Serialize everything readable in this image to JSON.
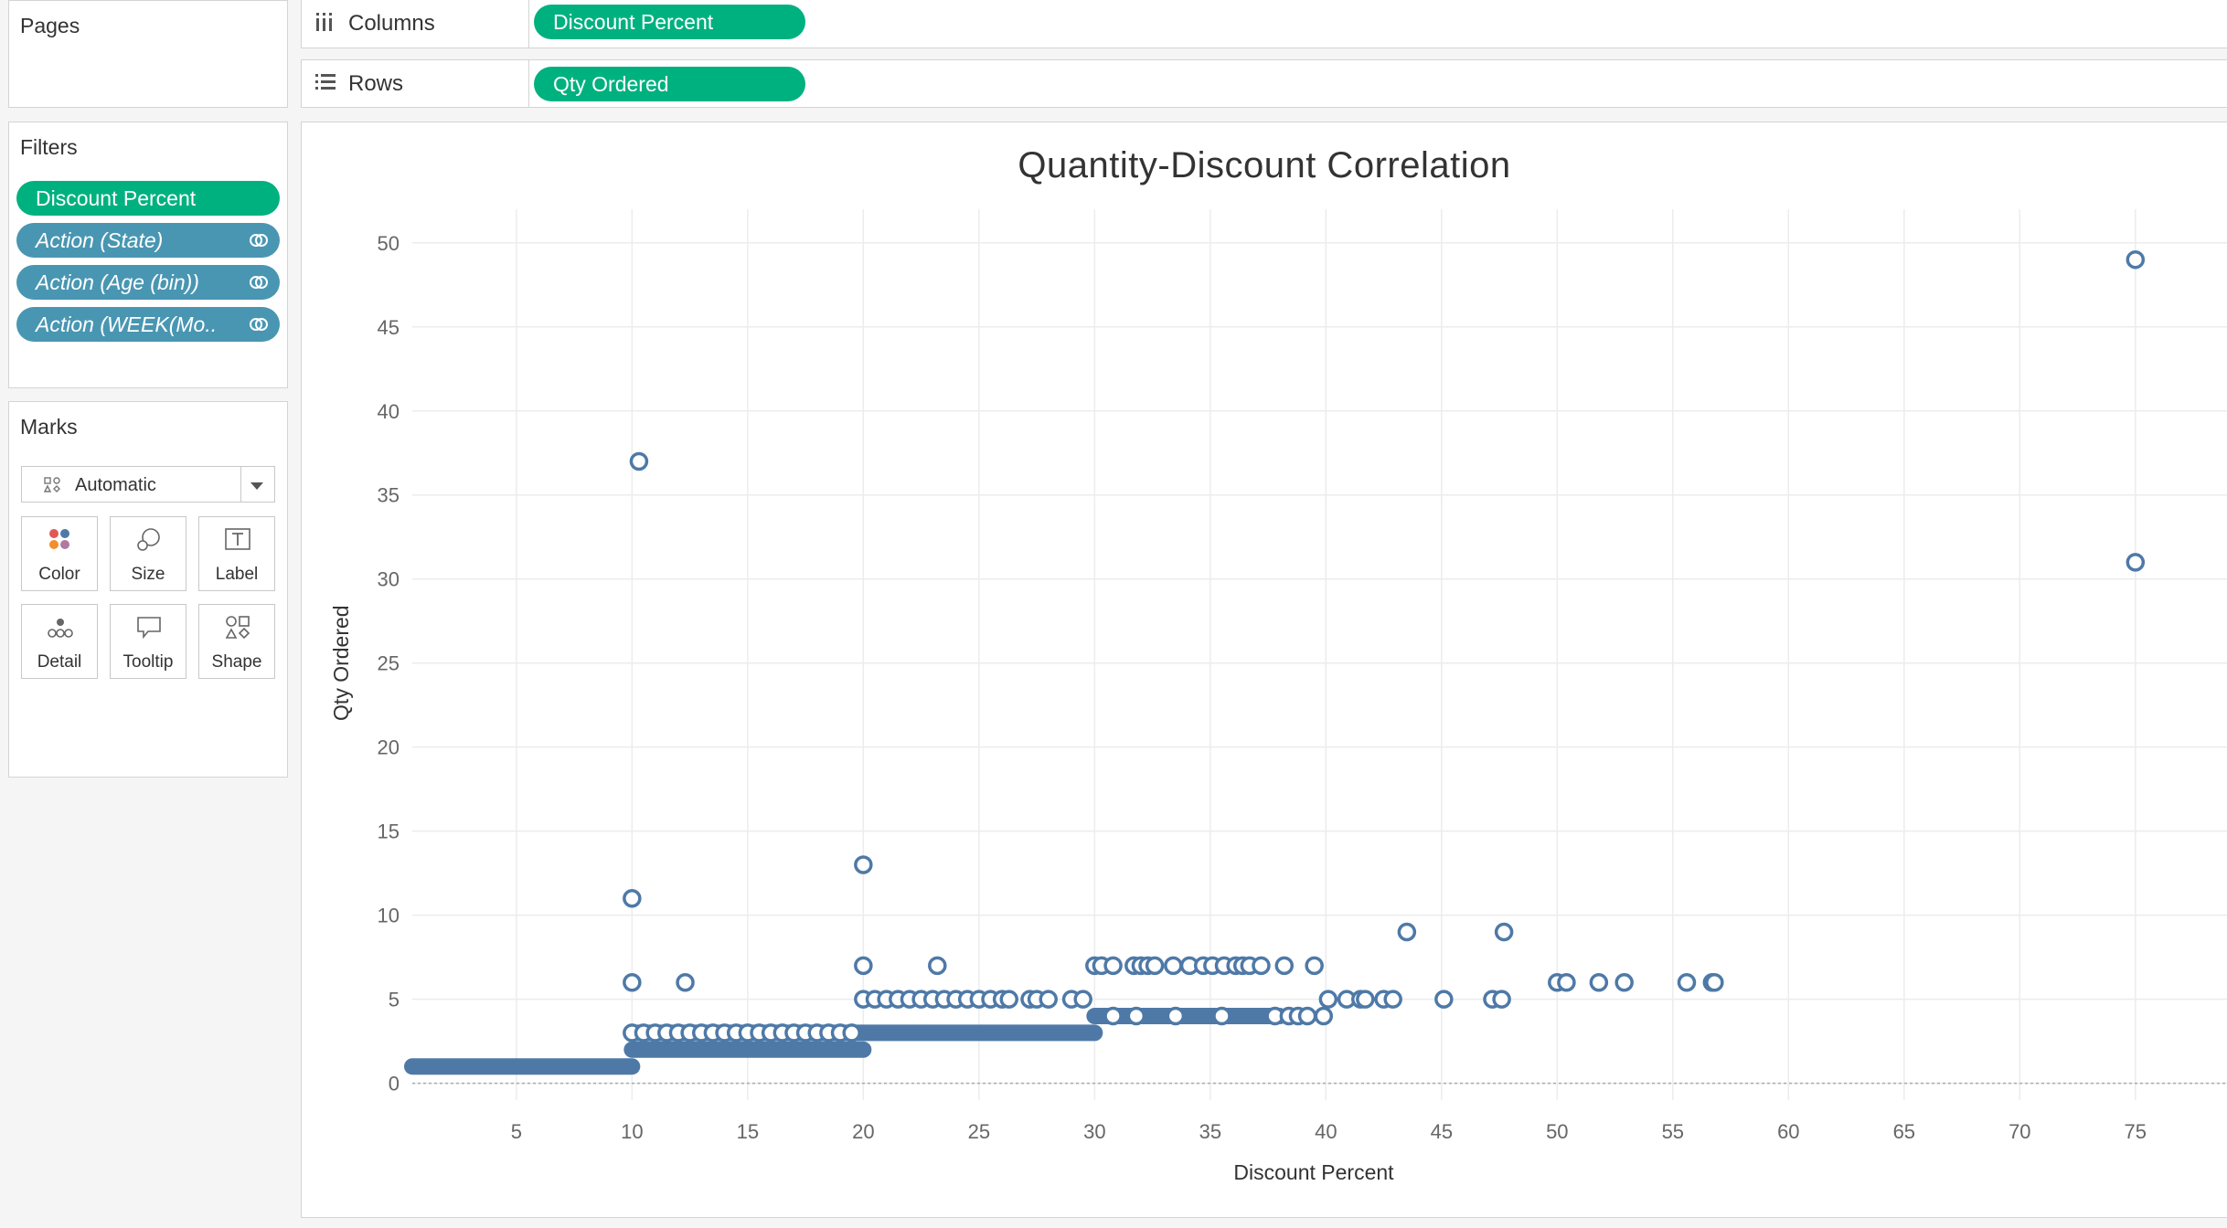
{
  "sidebar": {
    "pages": {
      "title": "Pages"
    },
    "filters": {
      "title": "Filters",
      "items": [
        {
          "label": "Discount Percent",
          "kind": "measure"
        },
        {
          "label": "Action (State)",
          "kind": "action"
        },
        {
          "label": "Action (Age (bin))",
          "kind": "action"
        },
        {
          "label": "Action (WEEK(Mo..",
          "kind": "action"
        }
      ]
    },
    "marks": {
      "title": "Marks",
      "type_select": "Automatic",
      "buttons": [
        {
          "label": "Color",
          "icon": "color-icon"
        },
        {
          "label": "Size",
          "icon": "size-icon"
        },
        {
          "label": "Label",
          "icon": "label-icon"
        },
        {
          "label": "Detail",
          "icon": "detail-icon"
        },
        {
          "label": "Tooltip",
          "icon": "tooltip-icon"
        },
        {
          "label": "Shape",
          "icon": "shape-icon"
        }
      ]
    }
  },
  "shelves": {
    "columns": {
      "label": "Columns",
      "pill": "Discount Percent"
    },
    "rows": {
      "label": "Rows",
      "pill": "Qty Ordered"
    }
  },
  "colors": {
    "measure_pill": "#00b180",
    "action_pill": "#4996b2",
    "mark": "#4e79a7"
  },
  "chart_data": {
    "type": "scatter",
    "title": "Quantity-Discount Correlation",
    "xlabel": "Discount Percent",
    "ylabel": "Qty Ordered",
    "xlim": [
      0.5,
      79
    ],
    "ylim": [
      -1,
      52
    ],
    "xticks": [
      5,
      10,
      15,
      20,
      25,
      30,
      35,
      40,
      45,
      50,
      55,
      60,
      65,
      70,
      75
    ],
    "yticks": [
      0,
      5,
      10,
      15,
      20,
      25,
      30,
      35,
      40,
      45,
      50
    ],
    "grid": true,
    "marker": "open-circle",
    "bands": [
      {
        "y": 1,
        "x_from": 0.5,
        "x_to": 10
      },
      {
        "y": 2,
        "x_from": 10,
        "x_to": 20
      },
      {
        "y": 3,
        "x_from": 10,
        "x_to": 30
      },
      {
        "y": 4,
        "x_from": 30,
        "x_to": 38
      }
    ],
    "points": [
      [
        10.3,
        37
      ],
      [
        75,
        49
      ],
      [
        75,
        31
      ],
      [
        10,
        11
      ],
      [
        20,
        13
      ],
      [
        10,
        6
      ],
      [
        12.3,
        6
      ],
      [
        20,
        7
      ],
      [
        23.2,
        7
      ],
      [
        10,
        3
      ],
      [
        10.5,
        3
      ],
      [
        11,
        3
      ],
      [
        11.5,
        3
      ],
      [
        12,
        3
      ],
      [
        12.5,
        3
      ],
      [
        13,
        3
      ],
      [
        13.5,
        3
      ],
      [
        14,
        3
      ],
      [
        14.5,
        3
      ],
      [
        15,
        3
      ],
      [
        15.5,
        3
      ],
      [
        16,
        3
      ],
      [
        16.5,
        3
      ],
      [
        17,
        3
      ],
      [
        17.5,
        3
      ],
      [
        18,
        3
      ],
      [
        18.5,
        3
      ],
      [
        19,
        3
      ],
      [
        19.5,
        3
      ],
      [
        20,
        5
      ],
      [
        20.5,
        5
      ],
      [
        21,
        5
      ],
      [
        21.5,
        5
      ],
      [
        22,
        5
      ],
      [
        22.5,
        5
      ],
      [
        23,
        5
      ],
      [
        23.5,
        5
      ],
      [
        24,
        5
      ],
      [
        24.5,
        5
      ],
      [
        25,
        5
      ],
      [
        25.5,
        5
      ],
      [
        26,
        5
      ],
      [
        26.3,
        5
      ],
      [
        27.2,
        5
      ],
      [
        27.5,
        5
      ],
      [
        28,
        5
      ],
      [
        29,
        5
      ],
      [
        29.5,
        5
      ],
      [
        30,
        7
      ],
      [
        30.3,
        7
      ],
      [
        30.8,
        7
      ],
      [
        31.7,
        7
      ],
      [
        32,
        7
      ],
      [
        32.3,
        7
      ],
      [
        32.6,
        7
      ],
      [
        33.4,
        7
      ],
      [
        34.1,
        7
      ],
      [
        34.7,
        7
      ],
      [
        35.1,
        7
      ],
      [
        35.6,
        7
      ],
      [
        36.1,
        7
      ],
      [
        36.4,
        7
      ],
      [
        36.7,
        7
      ],
      [
        37.2,
        7
      ],
      [
        38.2,
        7
      ],
      [
        39.5,
        7
      ],
      [
        30.8,
        4
      ],
      [
        31.8,
        4
      ],
      [
        33.5,
        4
      ],
      [
        35.5,
        4
      ],
      [
        37.8,
        4
      ],
      [
        38.4,
        4
      ],
      [
        38.8,
        4
      ],
      [
        39.2,
        4
      ],
      [
        39.9,
        4
      ],
      [
        40.1,
        5
      ],
      [
        40.9,
        5
      ],
      [
        41.5,
        5
      ],
      [
        41.7,
        5
      ],
      [
        42.5,
        5
      ],
      [
        42.9,
        5
      ],
      [
        45.1,
        5
      ],
      [
        47.2,
        5
      ],
      [
        47.6,
        5
      ],
      [
        43.5,
        9
      ],
      [
        47.7,
        9
      ],
      [
        50,
        6
      ],
      [
        50.4,
        6
      ],
      [
        51.8,
        6
      ],
      [
        52.9,
        6
      ],
      [
        55.6,
        6
      ],
      [
        56.7,
        6
      ],
      [
        56.8,
        6
      ]
    ]
  }
}
